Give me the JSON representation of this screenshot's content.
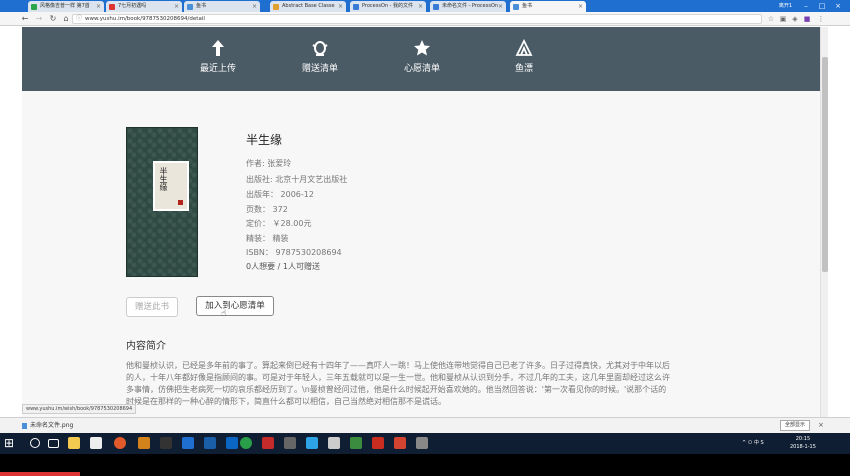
{
  "browser": {
    "tabs": [
      {
        "label": "风格像吉普一样 第7首"
      },
      {
        "label": "7七月初遇吗"
      },
      {
        "label": "鱼书"
      },
      {
        "label": "Abstract Base Classe"
      },
      {
        "label": "ProcessOn - 我的文件"
      },
      {
        "label": "未命名文件 - ProcessOn"
      },
      {
        "label": "鱼书"
      }
    ],
    "user_label": "离开1",
    "url": "www.yushu.im/book/9787530208694/detail"
  },
  "site_nav": [
    {
      "icon": "upload-icon",
      "label": "最近上传"
    },
    {
      "icon": "gift-icon",
      "label": "赠送清单"
    },
    {
      "icon": "star-icon",
      "label": "心愿清单"
    },
    {
      "icon": "fish-icon",
      "label": "鱼漂"
    }
  ],
  "book": {
    "cover_title": "半生缘",
    "title": "半生缘",
    "author": "作者: 张爱玲",
    "publisher": "出版社: 北京十月文艺出版社",
    "pubdate": "出版年： 2006-12",
    "pages": "页数： 372",
    "price": "定价： ￥28.00元",
    "binding": "精装： 精装",
    "isbn": "ISBN： 9787530208694",
    "wish_gift": "0人想要 / 1人可赠送"
  },
  "actions": {
    "gift_label": "赠送此书",
    "wish_label": "加入到心愿清单"
  },
  "intro": {
    "heading": "内容简介",
    "text": "他和曼桢认识，已经是多年前的事了。算起来倒已经有十四年了——真吓人一跳！马上使他连带地觉得自己已老了许多。日子过得真快，尤其对于中年以后的人，十年八年都好像是指顾间的事。可是对于年轻人，三年五载就可以是一生一世。他和曼桢从认识到分手，不过几年的工夫，这几年里面却经过这么许多事情，仿佛把生老病死一切的哀乐都经历到了。\\n曼桢曾经问过他，他是什么时候起开始喜欢她的。他当然回答说：'第一次看见你的时候。'说那个话的时候是在那样的一种心醉的情形下，简直什么都可以相信，自己当然绝对相信那不是谎话。"
  },
  "status_url": "www.yushu.im/wish/book/9787530208694",
  "download": {
    "file": "未命名文件.png",
    "show_all": "全部显示"
  },
  "taskbar": {
    "tray": "^ ㅁ 中 S",
    "time": "20:15",
    "date": "2018-1-15"
  }
}
